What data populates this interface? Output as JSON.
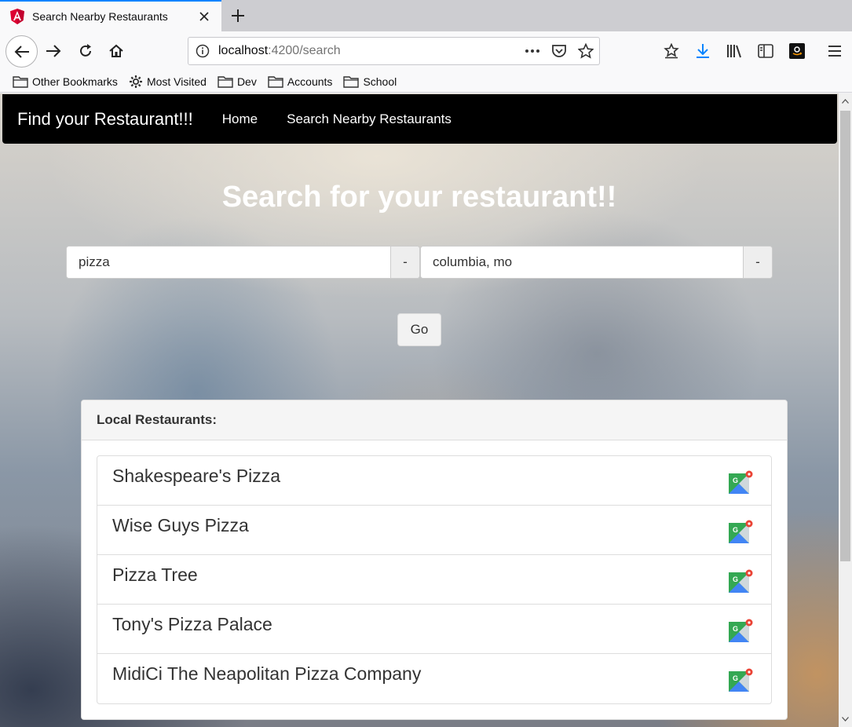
{
  "browser": {
    "tab_title": "Search Nearby Restaurants",
    "url_host": "localhost",
    "url_rest": ":4200/search",
    "bookmarks": [
      "Other Bookmarks",
      "Most Visited",
      "Dev",
      "Accounts",
      "School"
    ]
  },
  "app": {
    "brand": "Find your Restaurant!!!",
    "nav": {
      "home": "Home",
      "search": "Search Nearby Restaurants"
    },
    "hero_title": "Search for your restaurant!!",
    "search": {
      "term_value": "pizza",
      "term_addon": "-",
      "location_value": "columbia, mo",
      "location_addon": "-",
      "go_label": "Go"
    },
    "results": {
      "heading": "Local Restaurants:",
      "items": [
        "Shakespeare's Pizza",
        "Wise Guys Pizza",
        "Pizza Tree",
        "Tony's Pizza Palace",
        "MidiCi The Neapolitan Pizza Company"
      ]
    }
  }
}
